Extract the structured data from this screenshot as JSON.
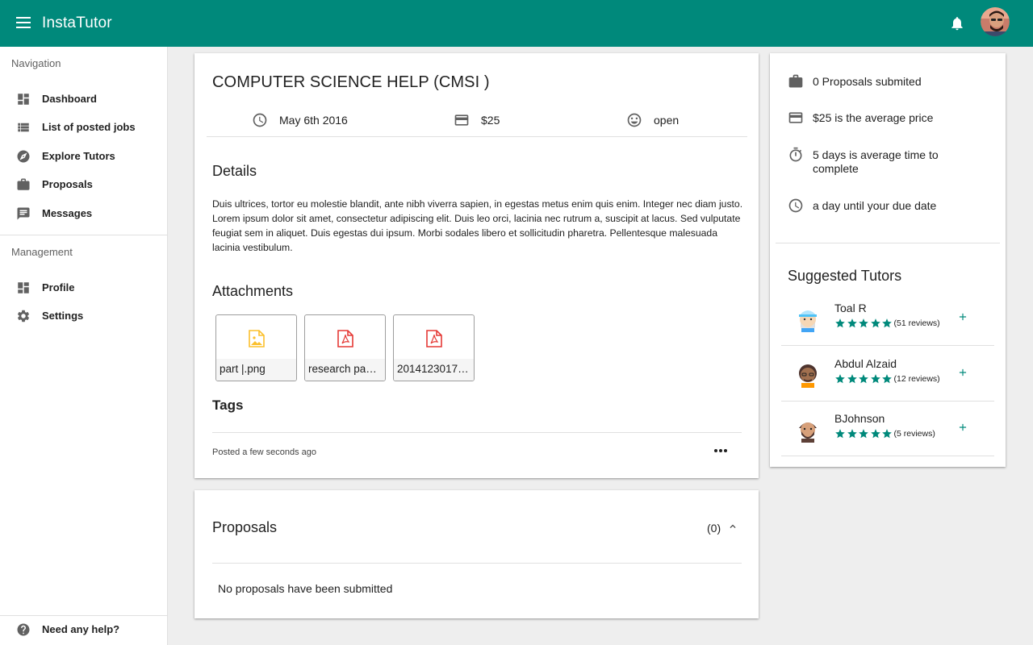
{
  "app": {
    "title": "InstaTutor"
  },
  "topbar": {
    "menu_icon": "menu-icon",
    "bell_icon": "notifications-icon",
    "avatar": "user-avatar"
  },
  "sidebar": {
    "navigation_label": "Navigation",
    "navigation": [
      {
        "label": "Dashboard",
        "icon": "dashboard-icon"
      },
      {
        "label": "List of posted jobs",
        "icon": "list-icon"
      },
      {
        "label": "Explore Tutors",
        "icon": "compass-icon"
      },
      {
        "label": "Proposals",
        "icon": "briefcase-icon"
      },
      {
        "label": "Messages",
        "icon": "message-icon"
      }
    ],
    "management_label": "Management",
    "management": [
      {
        "label": "Profile",
        "icon": "dashboard-icon"
      },
      {
        "label": "Settings",
        "icon": "gear-icon"
      }
    ],
    "help": {
      "label": "Need any help?",
      "icon": "help-icon"
    }
  },
  "job": {
    "title": "COMPUTER SCIENCE HELP (CMSI )",
    "date": "May 6th 2016",
    "price": "$25",
    "status": "open",
    "details_heading": "Details",
    "details": "Duis ultrices, tortor eu molestie blandit, ante nibh viverra sapien, in egestas metus enim quis enim. Integer nec diam justo. Lorem ipsum dolor sit amet, consectetur adipiscing elit. Duis leo orci, lacinia nec rutrum a, suscipit at lacus. Sed vulputate feugiat sem in aliquet. Duis egestas dui ipsum. Morbi sodales libero et sollicitudin pharetra. Pellentesque malesuada lacinia vestibulum.",
    "attachments_heading": "Attachments",
    "attachments": [
      {
        "name": "part |.png",
        "icon": "image-file-icon"
      },
      {
        "name": "research paper.pdf",
        "icon": "pdf-file-icon"
      },
      {
        "name": "20141230172915.pdf",
        "icon": "pdf-file-icon"
      }
    ],
    "tags_heading": "Tags",
    "posted": "Posted a few seconds ago"
  },
  "proposals": {
    "heading": "Proposals",
    "count": "(0)",
    "empty_text": "No proposals have been submitted"
  },
  "stats": [
    {
      "text": "0 Proposals submited",
      "icon": "briefcase-icon"
    },
    {
      "text": "$25 is the average price",
      "icon": "credit-card-icon"
    },
    {
      "text": "5 days is average time to complete",
      "icon": "timer-icon"
    },
    {
      "text": "a day until your due date",
      "icon": "clock-icon"
    }
  ],
  "suggested": {
    "heading": "Suggested Tutors",
    "tutors": [
      {
        "name": "Toal R",
        "rating": 5,
        "reviews": "(51 reviews)"
      },
      {
        "name": "Abdul Alzaid",
        "rating": 5,
        "reviews": "(12 reviews)"
      },
      {
        "name": "BJohnson",
        "rating": 5,
        "reviews": "(5 reviews)"
      }
    ]
  },
  "colors": {
    "primary": "#00897b",
    "star": "#00897b",
    "image_icon": "#fbc02d",
    "pdf_icon": "#e53935"
  }
}
